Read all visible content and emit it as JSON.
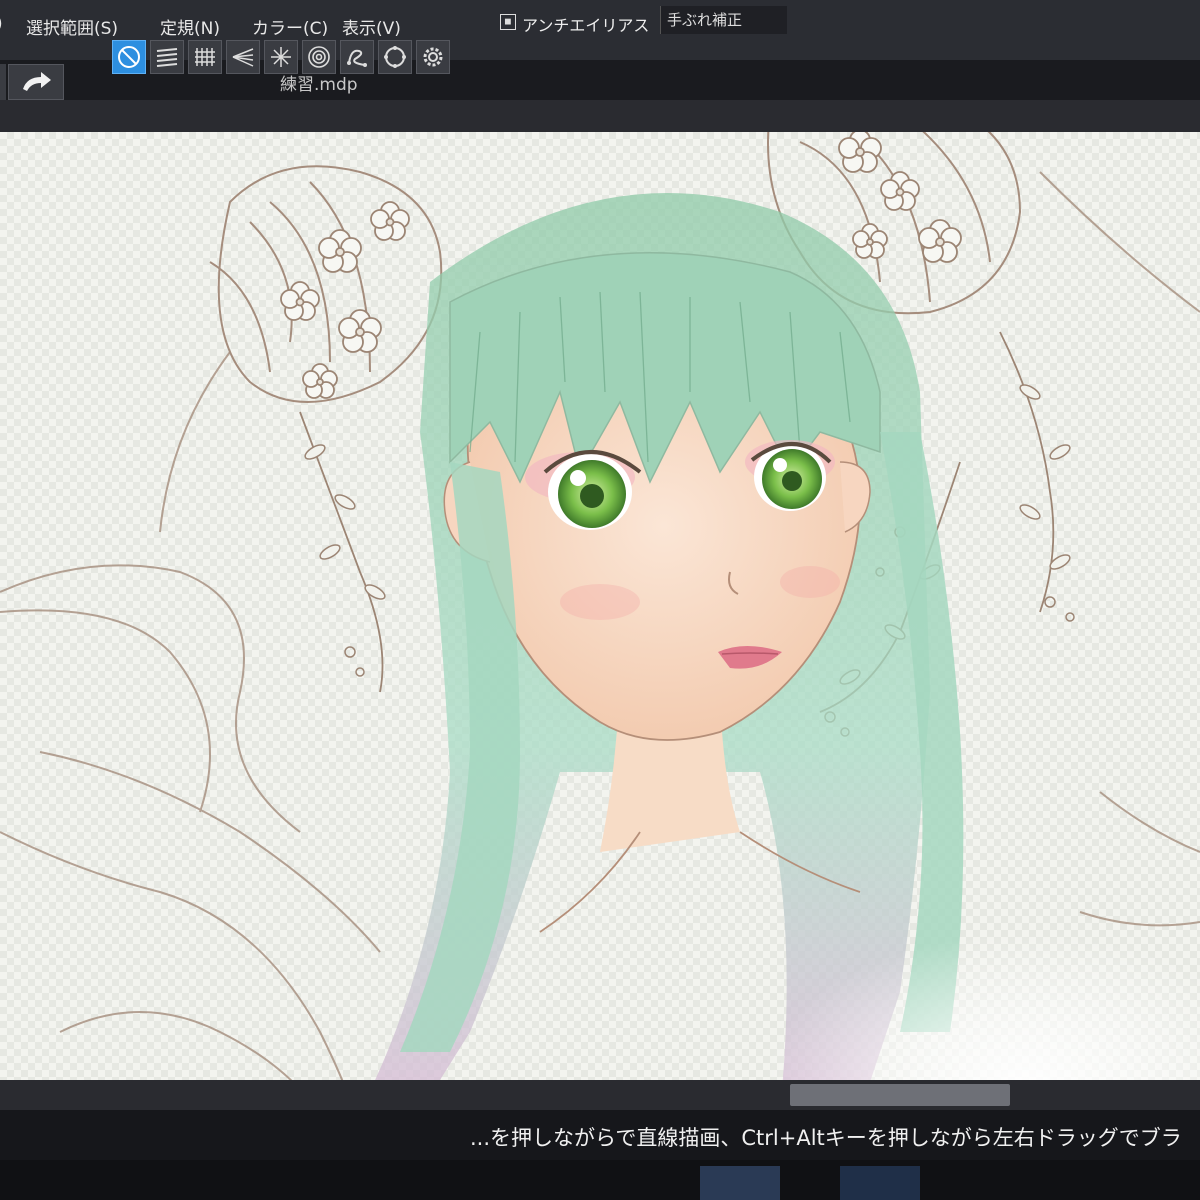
{
  "menu": {
    "items": [
      {
        "label": ")"
      },
      {
        "label": "選択範囲(S)"
      },
      {
        "label": "定規(N)"
      },
      {
        "label": "カラー(C)"
      },
      {
        "label": "表示(V)"
      }
    ]
  },
  "toolbar": {
    "antialias_label": "アンチエイリアス",
    "correction_label": "手ぶれ補正",
    "active_tool": "no-snap",
    "tools": [
      "no-snap",
      "parallel-lines",
      "grid",
      "perspective",
      "radial",
      "concentric",
      "curve",
      "circle",
      "settings"
    ]
  },
  "document": {
    "filename": "練習.mdp"
  },
  "statusbar": {
    "hint": "...を押しながらで直線描画、Ctrl+Altキーを押しながら左右ドラッグでブラ"
  },
  "colors": {
    "active_tool": "#2d8fe0",
    "menubar": "#2b2d33",
    "line_art": "#a58d7d",
    "hair": "#9ccdb3",
    "eye": "#7bbf4a",
    "lips": "#e07a8c"
  }
}
